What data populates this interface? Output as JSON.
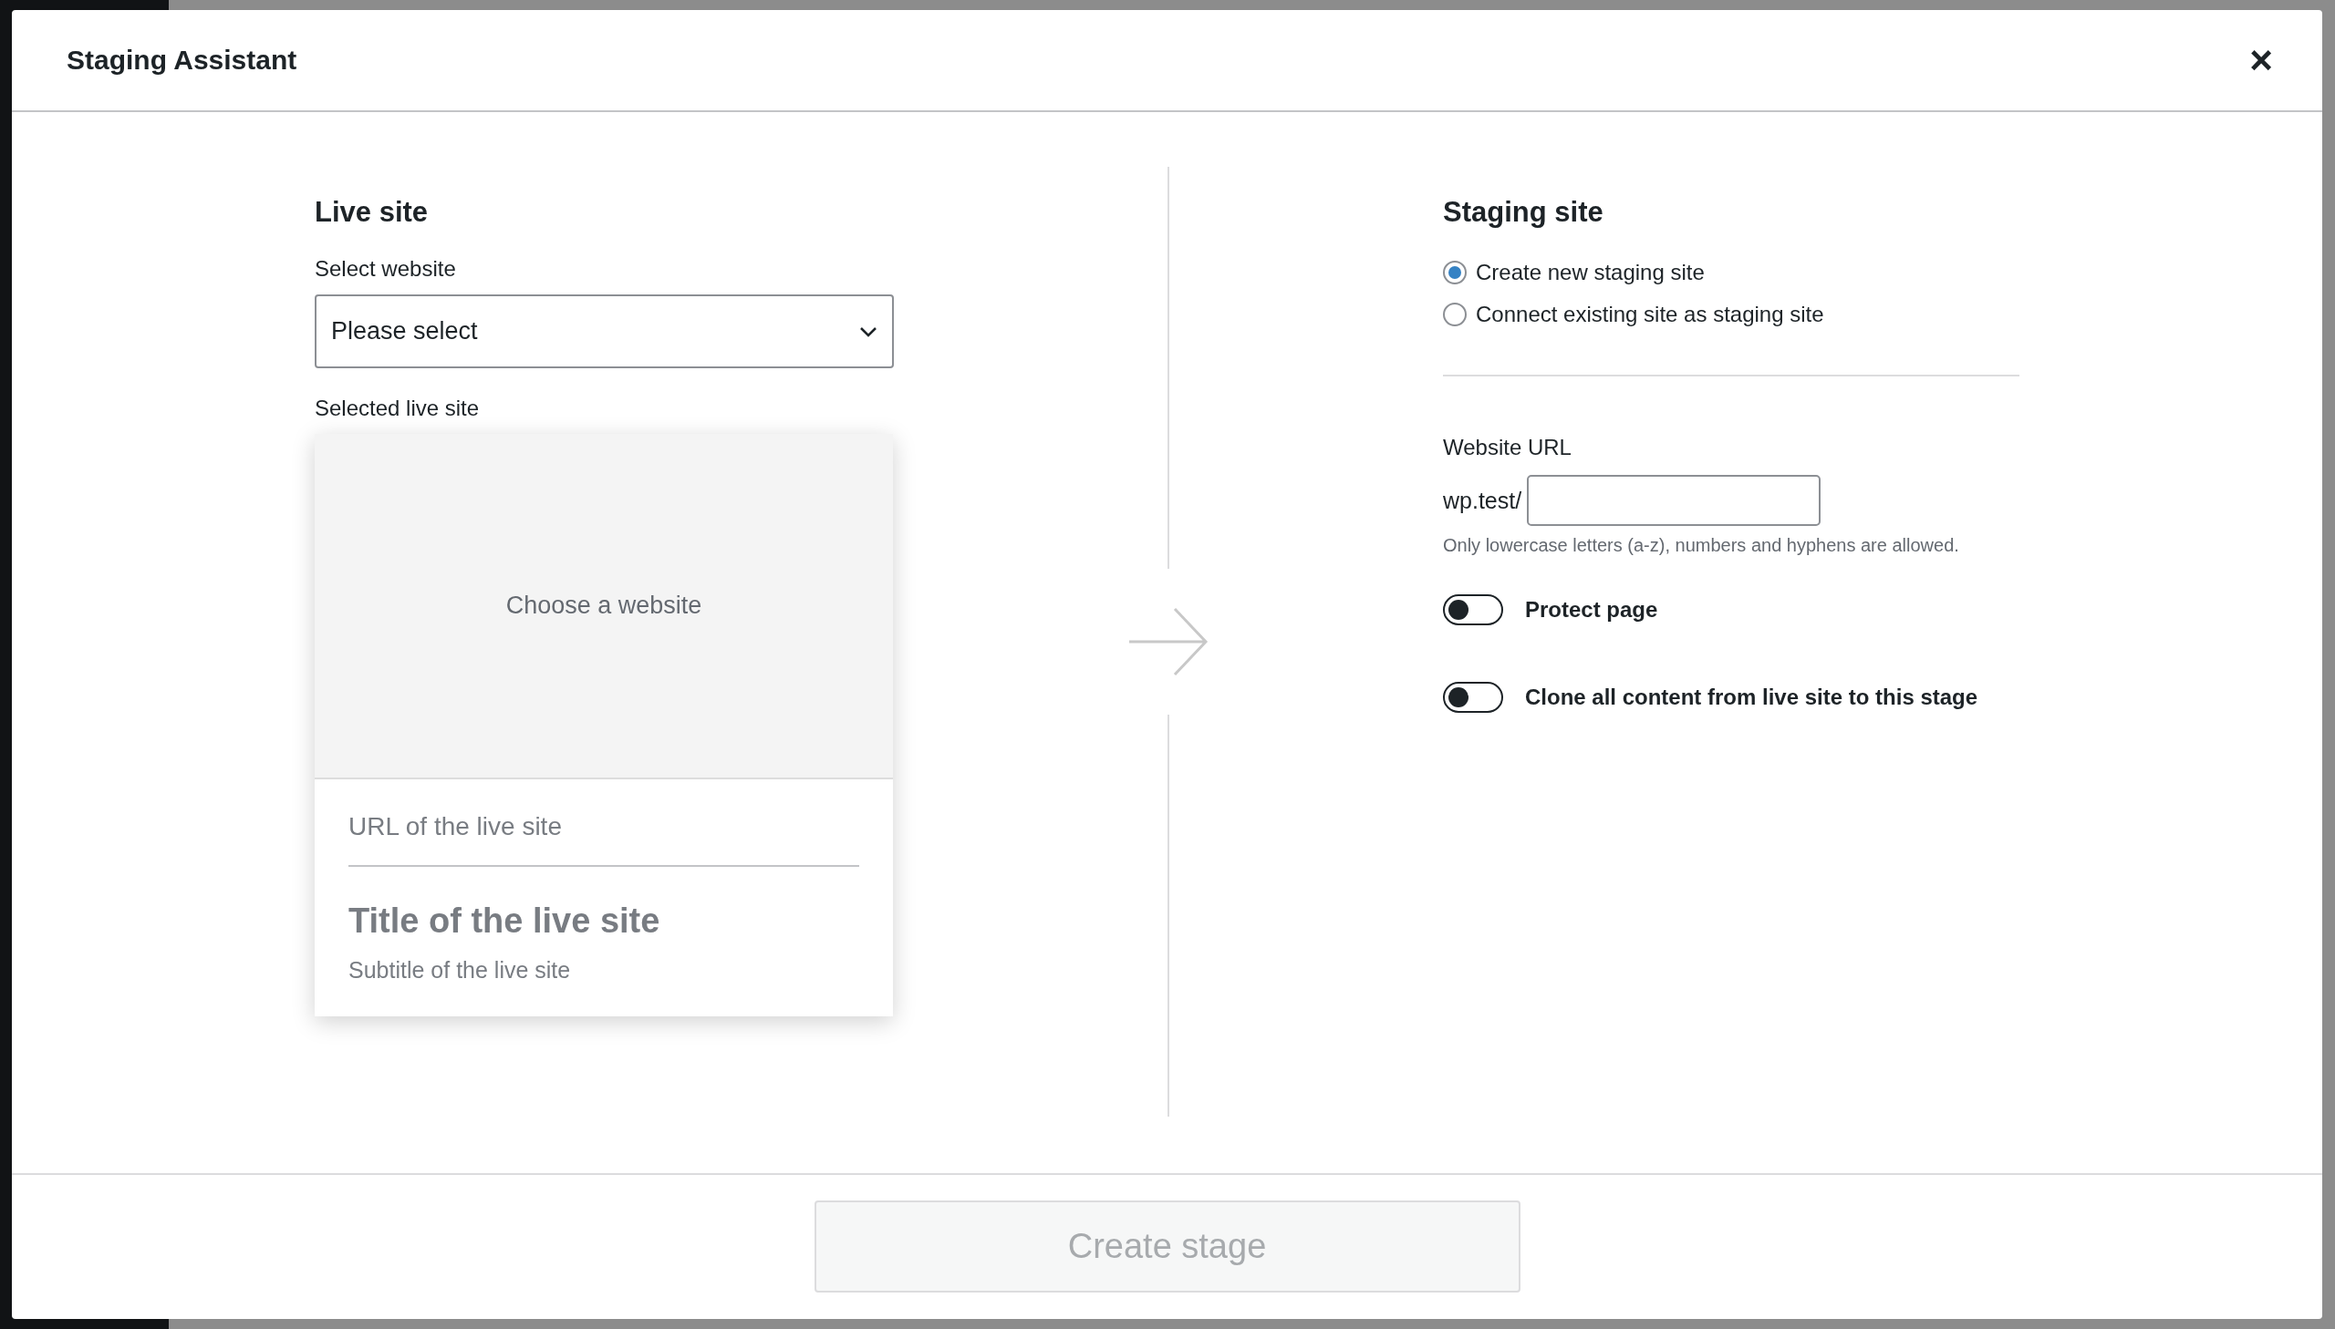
{
  "dialog": {
    "title": "Staging Assistant",
    "close": "×",
    "live_site": {
      "heading": "Live site",
      "select_label": "Select website",
      "select": {
        "value": "Please select"
      },
      "selected_label": "Selected live site",
      "card": {
        "preview_text": "Choose a website",
        "url": "URL of the live site",
        "title": "Title of the live site",
        "subtitle": "Subtitle of the live site"
      }
    },
    "staging_site": {
      "heading": "Staging site",
      "options": [
        {
          "label": "Create new staging site",
          "selected": true
        },
        {
          "label": "Connect existing site as staging site",
          "selected": false
        }
      ],
      "url_label": "Website URL",
      "url_prefix": "wp.test/",
      "url_hint": "Only lowercase letters (a-z), numbers and hyphens are allowed.",
      "toggles": [
        {
          "label": "Protect page",
          "on": false
        },
        {
          "label": "Clone all content from live site to this stage",
          "on": false
        }
      ]
    },
    "button": {
      "label": "Create stage",
      "disabled": true
    }
  }
}
